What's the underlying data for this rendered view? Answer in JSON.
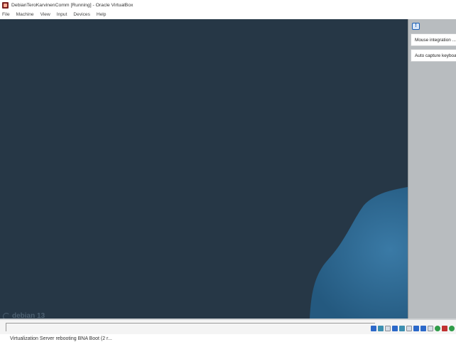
{
  "window": {
    "title": "DebianTeroKarvinenComm [Running] - Oracle VirtualBox"
  },
  "menu": [
    {
      "label": "File"
    },
    {
      "label": "Machine"
    },
    {
      "label": "View"
    },
    {
      "label": "Input"
    },
    {
      "label": "Devices"
    },
    {
      "label": "Help"
    }
  ],
  "vm": {
    "os_brand": "debian 13",
    "background_color": "#263746",
    "accent_color": "#2f6a95"
  },
  "notifications": {
    "icon": "info-icon",
    "items": [
      {
        "text": "Mouse integration ..."
      },
      {
        "text": "Auto capture keyboa"
      }
    ]
  },
  "statusbar": {
    "icons": [
      "hard-disk-icon",
      "optical-drive-icon",
      "audio-icon",
      "network-icon",
      "usb-icon",
      "shared-folders-icon",
      "display-icon",
      "video-capture-icon",
      "keyboard-icon",
      "mouse-icon",
      "cpu-icon",
      "host-key-icon"
    ]
  },
  "caption": {
    "text": "Virtualization  Server  rebooting  BNA  Boot  (2 r..."
  }
}
